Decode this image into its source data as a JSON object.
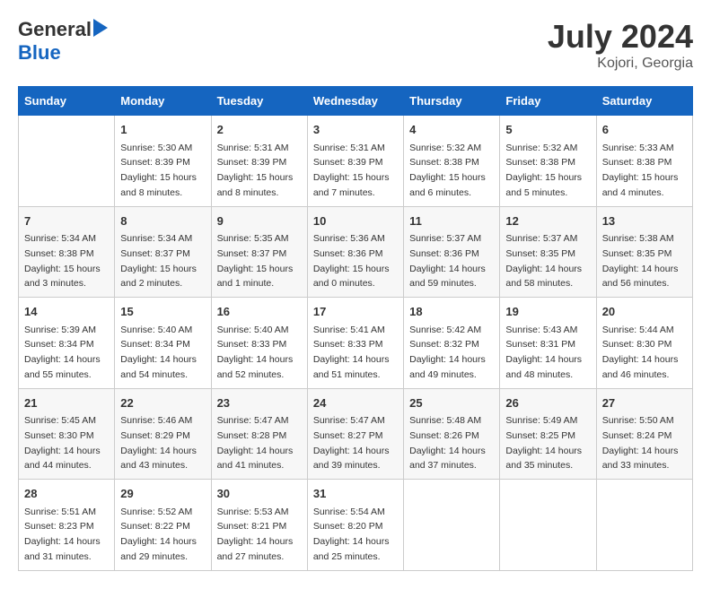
{
  "header": {
    "logo_general": "General",
    "logo_blue": "Blue",
    "month_year": "July 2024",
    "location": "Kojori, Georgia"
  },
  "days_of_week": [
    "Sunday",
    "Monday",
    "Tuesday",
    "Wednesday",
    "Thursday",
    "Friday",
    "Saturday"
  ],
  "weeks": [
    [
      {
        "day": "",
        "sunrise": "",
        "sunset": "",
        "daylight": ""
      },
      {
        "day": "1",
        "sunrise": "Sunrise: 5:30 AM",
        "sunset": "Sunset: 8:39 PM",
        "daylight": "Daylight: 15 hours and 8 minutes."
      },
      {
        "day": "2",
        "sunrise": "Sunrise: 5:31 AM",
        "sunset": "Sunset: 8:39 PM",
        "daylight": "Daylight: 15 hours and 8 minutes."
      },
      {
        "day": "3",
        "sunrise": "Sunrise: 5:31 AM",
        "sunset": "Sunset: 8:39 PM",
        "daylight": "Daylight: 15 hours and 7 minutes."
      },
      {
        "day": "4",
        "sunrise": "Sunrise: 5:32 AM",
        "sunset": "Sunset: 8:38 PM",
        "daylight": "Daylight: 15 hours and 6 minutes."
      },
      {
        "day": "5",
        "sunrise": "Sunrise: 5:32 AM",
        "sunset": "Sunset: 8:38 PM",
        "daylight": "Daylight: 15 hours and 5 minutes."
      },
      {
        "day": "6",
        "sunrise": "Sunrise: 5:33 AM",
        "sunset": "Sunset: 8:38 PM",
        "daylight": "Daylight: 15 hours and 4 minutes."
      }
    ],
    [
      {
        "day": "7",
        "sunrise": "Sunrise: 5:34 AM",
        "sunset": "Sunset: 8:38 PM",
        "daylight": "Daylight: 15 hours and 3 minutes."
      },
      {
        "day": "8",
        "sunrise": "Sunrise: 5:34 AM",
        "sunset": "Sunset: 8:37 PM",
        "daylight": "Daylight: 15 hours and 2 minutes."
      },
      {
        "day": "9",
        "sunrise": "Sunrise: 5:35 AM",
        "sunset": "Sunset: 8:37 PM",
        "daylight": "Daylight: 15 hours and 1 minute."
      },
      {
        "day": "10",
        "sunrise": "Sunrise: 5:36 AM",
        "sunset": "Sunset: 8:36 PM",
        "daylight": "Daylight: 15 hours and 0 minutes."
      },
      {
        "day": "11",
        "sunrise": "Sunrise: 5:37 AM",
        "sunset": "Sunset: 8:36 PM",
        "daylight": "Daylight: 14 hours and 59 minutes."
      },
      {
        "day": "12",
        "sunrise": "Sunrise: 5:37 AM",
        "sunset": "Sunset: 8:35 PM",
        "daylight": "Daylight: 14 hours and 58 minutes."
      },
      {
        "day": "13",
        "sunrise": "Sunrise: 5:38 AM",
        "sunset": "Sunset: 8:35 PM",
        "daylight": "Daylight: 14 hours and 56 minutes."
      }
    ],
    [
      {
        "day": "14",
        "sunrise": "Sunrise: 5:39 AM",
        "sunset": "Sunset: 8:34 PM",
        "daylight": "Daylight: 14 hours and 55 minutes."
      },
      {
        "day": "15",
        "sunrise": "Sunrise: 5:40 AM",
        "sunset": "Sunset: 8:34 PM",
        "daylight": "Daylight: 14 hours and 54 minutes."
      },
      {
        "day": "16",
        "sunrise": "Sunrise: 5:40 AM",
        "sunset": "Sunset: 8:33 PM",
        "daylight": "Daylight: 14 hours and 52 minutes."
      },
      {
        "day": "17",
        "sunrise": "Sunrise: 5:41 AM",
        "sunset": "Sunset: 8:33 PM",
        "daylight": "Daylight: 14 hours and 51 minutes."
      },
      {
        "day": "18",
        "sunrise": "Sunrise: 5:42 AM",
        "sunset": "Sunset: 8:32 PM",
        "daylight": "Daylight: 14 hours and 49 minutes."
      },
      {
        "day": "19",
        "sunrise": "Sunrise: 5:43 AM",
        "sunset": "Sunset: 8:31 PM",
        "daylight": "Daylight: 14 hours and 48 minutes."
      },
      {
        "day": "20",
        "sunrise": "Sunrise: 5:44 AM",
        "sunset": "Sunset: 8:30 PM",
        "daylight": "Daylight: 14 hours and 46 minutes."
      }
    ],
    [
      {
        "day": "21",
        "sunrise": "Sunrise: 5:45 AM",
        "sunset": "Sunset: 8:30 PM",
        "daylight": "Daylight: 14 hours and 44 minutes."
      },
      {
        "day": "22",
        "sunrise": "Sunrise: 5:46 AM",
        "sunset": "Sunset: 8:29 PM",
        "daylight": "Daylight: 14 hours and 43 minutes."
      },
      {
        "day": "23",
        "sunrise": "Sunrise: 5:47 AM",
        "sunset": "Sunset: 8:28 PM",
        "daylight": "Daylight: 14 hours and 41 minutes."
      },
      {
        "day": "24",
        "sunrise": "Sunrise: 5:47 AM",
        "sunset": "Sunset: 8:27 PM",
        "daylight": "Daylight: 14 hours and 39 minutes."
      },
      {
        "day": "25",
        "sunrise": "Sunrise: 5:48 AM",
        "sunset": "Sunset: 8:26 PM",
        "daylight": "Daylight: 14 hours and 37 minutes."
      },
      {
        "day": "26",
        "sunrise": "Sunrise: 5:49 AM",
        "sunset": "Sunset: 8:25 PM",
        "daylight": "Daylight: 14 hours and 35 minutes."
      },
      {
        "day": "27",
        "sunrise": "Sunrise: 5:50 AM",
        "sunset": "Sunset: 8:24 PM",
        "daylight": "Daylight: 14 hours and 33 minutes."
      }
    ],
    [
      {
        "day": "28",
        "sunrise": "Sunrise: 5:51 AM",
        "sunset": "Sunset: 8:23 PM",
        "daylight": "Daylight: 14 hours and 31 minutes."
      },
      {
        "day": "29",
        "sunrise": "Sunrise: 5:52 AM",
        "sunset": "Sunset: 8:22 PM",
        "daylight": "Daylight: 14 hours and 29 minutes."
      },
      {
        "day": "30",
        "sunrise": "Sunrise: 5:53 AM",
        "sunset": "Sunset: 8:21 PM",
        "daylight": "Daylight: 14 hours and 27 minutes."
      },
      {
        "day": "31",
        "sunrise": "Sunrise: 5:54 AM",
        "sunset": "Sunset: 8:20 PM",
        "daylight": "Daylight: 14 hours and 25 minutes."
      },
      {
        "day": "",
        "sunrise": "",
        "sunset": "",
        "daylight": ""
      },
      {
        "day": "",
        "sunrise": "",
        "sunset": "",
        "daylight": ""
      },
      {
        "day": "",
        "sunrise": "",
        "sunset": "",
        "daylight": ""
      }
    ]
  ]
}
